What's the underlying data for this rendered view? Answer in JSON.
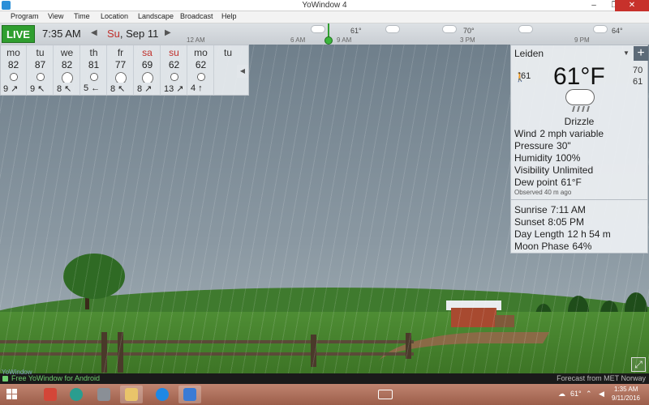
{
  "window": {
    "title": "YoWindow 4",
    "min": "–",
    "restore": "❐",
    "close": "✕"
  },
  "menu": [
    "Program",
    "View",
    "Time",
    "Location",
    "Landscape",
    "Broadcast",
    "Help"
  ],
  "timeline": {
    "live": "LIVE",
    "time": "7:35 AM",
    "prev": "◀",
    "next": "▶",
    "date_dow": "Su",
    "date_rest": ", Sep 11",
    "ticks": [
      "12 AM",
      "6 AM",
      "9 AM",
      "3 PM",
      "9 PM"
    ],
    "temps": [
      "61°",
      "70°",
      "64°"
    ]
  },
  "forecast": {
    "collapse": "◀",
    "days": [
      {
        "name": "mo",
        "temp": "82",
        "icon": "sun",
        "wind": "9 ↗",
        "weekend": false
      },
      {
        "name": "tu",
        "temp": "87",
        "icon": "sun",
        "wind": "9 ↖",
        "weekend": false
      },
      {
        "name": "we",
        "temp": "82",
        "icon": "cloud",
        "wind": "8 ↖",
        "weekend": false
      },
      {
        "name": "th",
        "temp": "81",
        "icon": "sun",
        "wind": "5 ←",
        "weekend": false
      },
      {
        "name": "fr",
        "temp": "77",
        "icon": "cloud",
        "wind": "8 ↖",
        "weekend": false
      },
      {
        "name": "sa",
        "temp": "69",
        "icon": "cloud",
        "wind": "8 ↗",
        "weekend": true
      },
      {
        "name": "su",
        "temp": "62",
        "icon": "sun",
        "wind": "13 ↗",
        "weekend": true
      },
      {
        "name": "mo",
        "temp": "62",
        "icon": "sun",
        "wind": "4 ↑",
        "weekend": false
      },
      {
        "name": "tu",
        "temp": "",
        "icon": "",
        "wind": "",
        "weekend": false
      }
    ]
  },
  "current": {
    "city": "Leiden",
    "dropdown": "▼",
    "add": "+",
    "feels_like": "61",
    "temp": "61°F",
    "high": "70",
    "low": "61",
    "condition": "Drizzle",
    "wind_label": "Wind",
    "wind_value": "2 mph variable",
    "pressure_label": "Pressure",
    "pressure_value": "30\"",
    "humidity_label": "Humidity",
    "humidity_value": "100%",
    "visibility_label": "Visibility",
    "visibility_value": "Unlimited",
    "dewpoint_label": "Dew point",
    "dewpoint_value": "61°F",
    "observed": "Observed 40 m ago",
    "sunrise_label": "Sunrise",
    "sunrise_value": "7:11 AM",
    "sunset_label": "Sunset",
    "sunset_value": "8:05 PM",
    "daylength_label": "Day Length",
    "daylength_value": "12 h 54 m",
    "moon_label": "Moon Phase",
    "moon_value": "64%"
  },
  "status": {
    "brand": "YoWindow",
    "promo": "Free YoWindow for Android",
    "credit": "Forecast from MET Norway"
  },
  "taskbar": {
    "temp": "61°",
    "time": "1:35 AM",
    "date": "9/11/2016"
  },
  "colors": {
    "live": "#2f9e2f",
    "weekend": "#c0302b",
    "taskbar": "#b0705c"
  }
}
